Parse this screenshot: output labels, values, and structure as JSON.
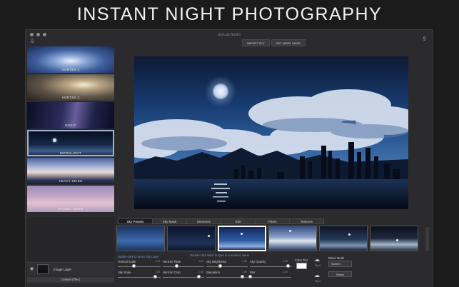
{
  "headline": "INSTANT NIGHT PHOTOGRAPHY",
  "window": {
    "title": "SkyLab Studio"
  },
  "toolbar": {
    "import_sky": "IMPORT SKY",
    "get_more_skies": "GET MORE SKIES"
  },
  "icons": {
    "import": "import-icon",
    "share": "share-icon",
    "visibility": "eye-icon"
  },
  "sidebar": {
    "items": [
      {
        "label": "VORTEX 1"
      },
      {
        "label": "VORTEX 2"
      },
      {
        "label": "NIGHT"
      },
      {
        "label": "MOONLIGHT",
        "selected": true
      },
      {
        "label": "HEAVY SKIES"
      },
      {
        "label": "PASTEL SKIES"
      }
    ],
    "layer_name": "Image Layer",
    "delete_label": "Delete Effect"
  },
  "tabs": [
    {
      "label": "Sky Presets",
      "active": true
    },
    {
      "label": "Sky Mask"
    },
    {
      "label": "Elements"
    },
    {
      "label": "Edit"
    },
    {
      "label": "Filters"
    },
    {
      "label": "Textures"
    }
  ],
  "hints": {
    "option_click": "Option-click to move Sky Layer",
    "double_click": "Double-click slider to type in a numeric value"
  },
  "controls": {
    "vertical_scale": {
      "label": "Vertical Scale",
      "value": "1.00"
    },
    "horizon_fade": {
      "label": "Horizon Fade",
      "value": "1.00"
    },
    "sky_brightness": {
      "label": "Sky Brightness",
      "value": "1.00"
    },
    "sky_opacity": {
      "label": "Sky Opacity",
      "value": "1.00"
    },
    "sky_scale": {
      "label": "Sky Scale",
      "value": "1.00"
    },
    "horizon_crop": {
      "label": "Horizon Crop",
      "value": "1.00"
    },
    "saturation": {
      "label": "Saturation",
      "value": "1.00"
    },
    "blur": {
      "label": "Blur",
      "value": "1.00"
    },
    "color_tint": {
      "label": "Color Tint",
      "value": "#ffffff"
    }
  },
  "flip": {
    "top": "Flip H",
    "bottom": "Flip V"
  },
  "blend": {
    "label": "Blend Mode",
    "value": "Screen",
    "reset": "Reset"
  }
}
